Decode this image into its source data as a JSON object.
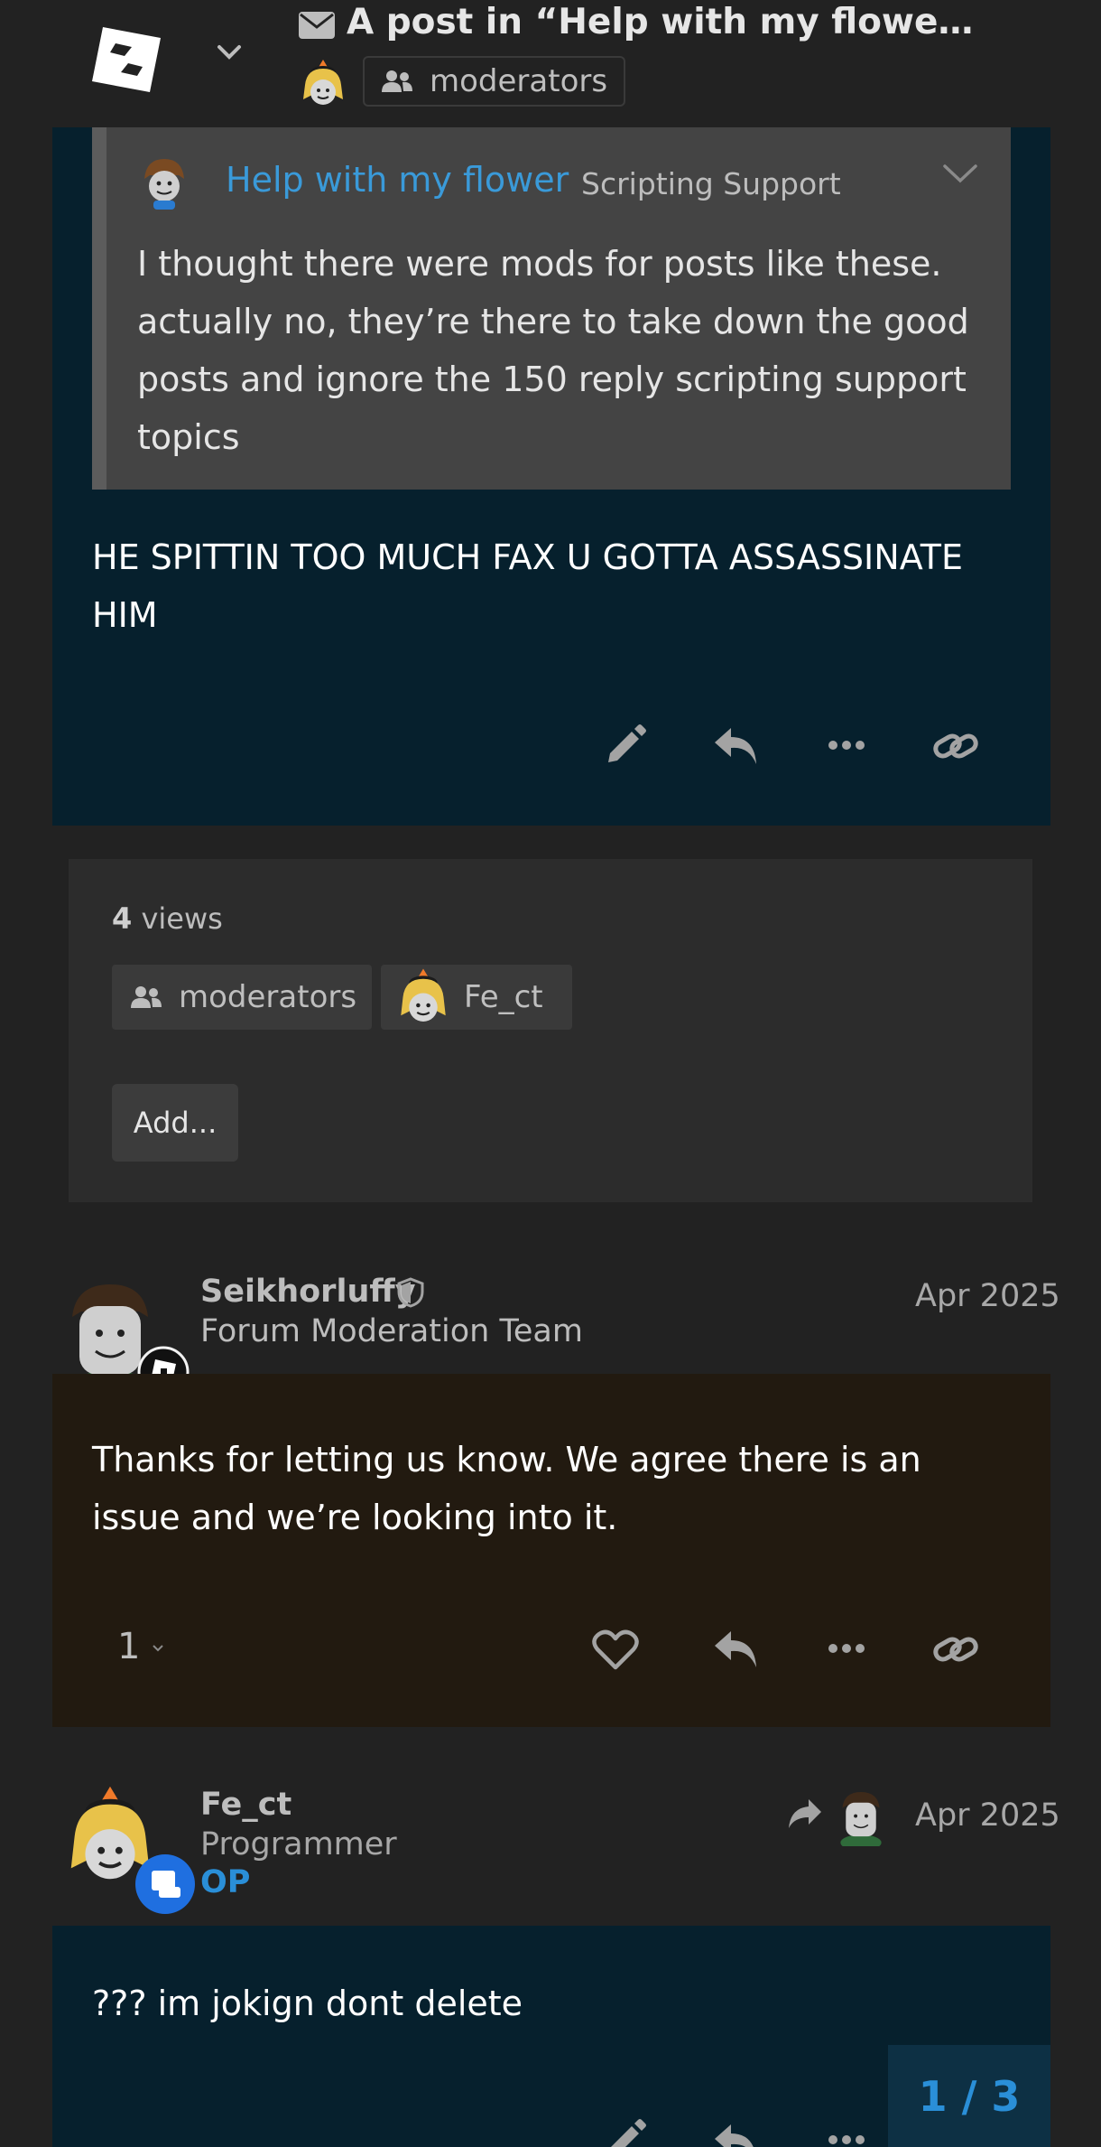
{
  "header": {
    "title": "A post in “Help with my flower” re...",
    "group_label": "moderators"
  },
  "quote": {
    "topic_link": "Help with my flower",
    "category": "Scripting Support",
    "text": "I thought there were mods for posts like these. actually no, they’re there to take down the good posts and ignore the 150 reply scripting support topics"
  },
  "post1": {
    "body": "HE SPITTIN TOO MUCH FAX U GOTTA ASSASSINATE HIM"
  },
  "small_action": {
    "views_count": "4",
    "views_label": "views",
    "participants": [
      "moderators",
      "Fe_ct"
    ],
    "add_label": "Add..."
  },
  "post2": {
    "username": "Seikhorluffy",
    "user_title": "Forum Moderation Team",
    "date": "Apr 2025",
    "body": "Thanks for letting us know. We agree there is an issue and we’re looking into it.",
    "like_count": "1"
  },
  "post3": {
    "username": "Fe_ct",
    "user_title": "Programmer",
    "op_label": "OP",
    "date": "Apr 2025",
    "body": "??? im jokign dont delete"
  },
  "pager": "1 / 3",
  "colors": {
    "background": "#222222",
    "post_own": "#06202d",
    "post_staff": "#221a10",
    "link": "#3a9ad9",
    "accent_blue": "#2a8fd8"
  },
  "icons": [
    "roblox-logo-icon",
    "chevron-down-icon",
    "envelope-icon",
    "users-icon",
    "pencil-icon",
    "reply-icon",
    "ellipsis-icon",
    "link-icon",
    "heart-icon",
    "shield-icon",
    "share-icon"
  ]
}
